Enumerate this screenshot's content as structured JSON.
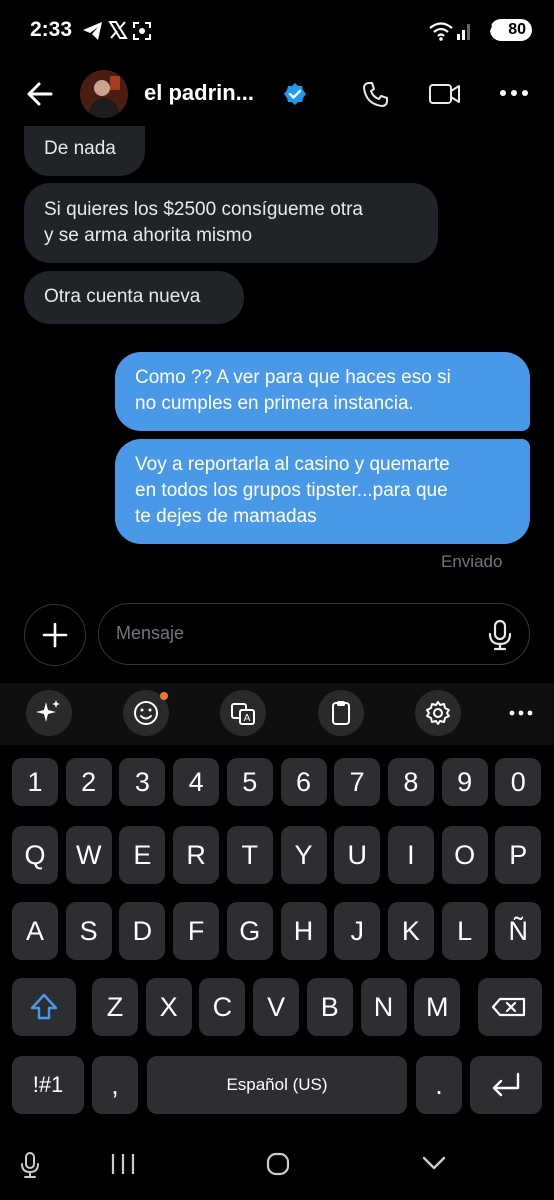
{
  "status_bar": {
    "time": "2:33",
    "battery": "80"
  },
  "header": {
    "contact_name": "el padrin...",
    "verified": true
  },
  "messages": [
    {
      "direction": "in",
      "text": "De nada"
    },
    {
      "direction": "in",
      "lines": [
        "Si quieres los $2500 consígueme otra",
        "y se arma ahorita mismo"
      ]
    },
    {
      "direction": "in",
      "text": "Otra cuenta nueva"
    },
    {
      "direction": "out",
      "lines": [
        "Como ?? A ver para que haces eso si",
        "no cumples en primera instancia."
      ]
    },
    {
      "direction": "out",
      "lines": [
        "Voy a reportarla al casino y quemarte",
        "en todos los grupos tipster...para que",
        "te dejes de mamadas"
      ]
    }
  ],
  "message_status": "Enviado",
  "composer": {
    "placeholder": "Mensaje"
  },
  "keyboard": {
    "row_numbers": [
      "1",
      "2",
      "3",
      "4",
      "5",
      "6",
      "7",
      "8",
      "9",
      "0"
    ],
    "row_1": [
      "Q",
      "W",
      "E",
      "R",
      "T",
      "Y",
      "U",
      "I",
      "O",
      "P"
    ],
    "row_2": [
      "A",
      "S",
      "D",
      "F",
      "G",
      "H",
      "J",
      "K",
      "L",
      "Ñ"
    ],
    "row_3": [
      "Z",
      "X",
      "C",
      "V",
      "B",
      "N",
      "M"
    ],
    "symbols_label": "!#1",
    "comma_label": ",",
    "space_label": "Español (US)",
    "period_label": "."
  },
  "colors": {
    "accent": "#4a99e9",
    "incoming_bubble": "#202327",
    "verified": "#1d9bf0",
    "notification_dot": "#f4762a"
  }
}
